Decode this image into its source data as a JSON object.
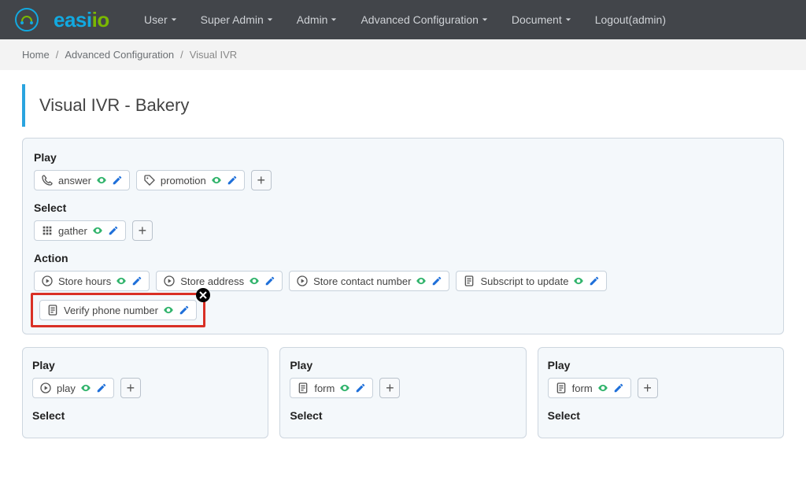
{
  "brand": {
    "easi": "easi",
    "io": "io"
  },
  "nav": {
    "user": {
      "label": "User"
    },
    "superadmin": {
      "label": "Super Admin"
    },
    "admin": {
      "label": "Admin"
    },
    "advconf": {
      "label": "Advanced Configuration"
    },
    "document": {
      "label": "Document"
    },
    "logout": {
      "label": "Logout(admin)"
    }
  },
  "breadcrumb": {
    "home": "Home",
    "advconf": "Advanced Configuration",
    "current": "Visual IVR"
  },
  "title": "Visual IVR - Bakery",
  "sections": {
    "play": {
      "title": "Play"
    },
    "select": {
      "title": "Select"
    },
    "action": {
      "title": "Action"
    }
  },
  "play_items": {
    "answer": {
      "label": "answer"
    },
    "promotion": {
      "label": "promotion"
    }
  },
  "select_items": {
    "gather": {
      "label": "gather"
    }
  },
  "action_items": {
    "store_hours": {
      "label": "Store hours"
    },
    "store_address": {
      "label": "Store address"
    },
    "store_contact": {
      "label": "Store contact number"
    },
    "subscript": {
      "label": "Subscript to update"
    },
    "verify_phone": {
      "label": "Verify phone number"
    }
  },
  "branches": [
    {
      "play": {
        "label": "play"
      }
    },
    {
      "form": {
        "label": "form"
      }
    },
    {
      "form": {
        "label": "form"
      }
    }
  ]
}
